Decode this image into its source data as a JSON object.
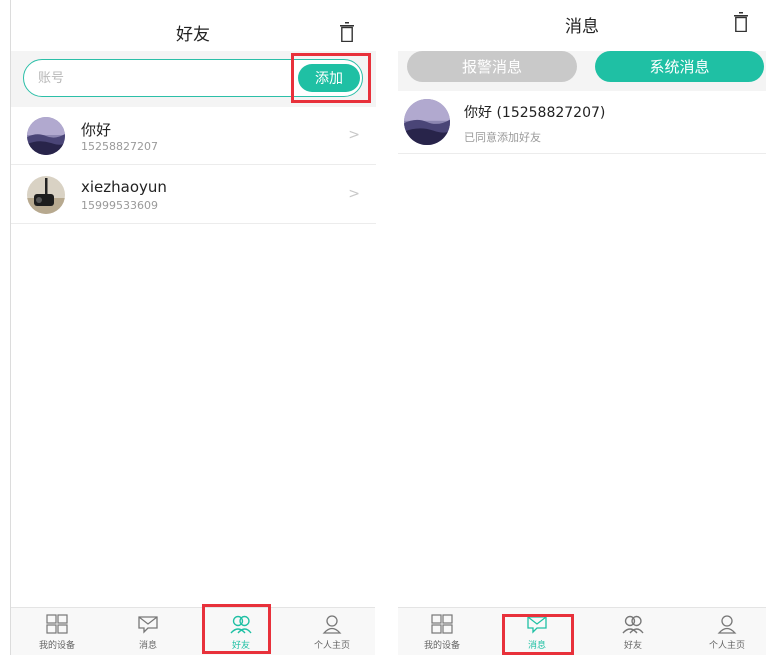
{
  "colors": {
    "accent": "#1fc0a4",
    "highlight": "#e8313b",
    "inactive_tab": "#c9c9c9"
  },
  "friends_screen": {
    "title": "好友",
    "trash_icon": "trash-icon",
    "search": {
      "placeholder": "账号",
      "value": ""
    },
    "add_button": "添加",
    "friends": [
      {
        "name": "你好",
        "phone": "15258827207",
        "avatar": "mountain-landscape"
      },
      {
        "name": "xiezhaoyun",
        "phone": "15999533609",
        "avatar": "camera-device-photo"
      }
    ],
    "chevron": ">"
  },
  "messages_screen": {
    "title": "消息",
    "trash_icon": "trash-icon",
    "tabs": [
      {
        "label": "报警消息",
        "active": false
      },
      {
        "label": "系统消息",
        "active": true
      }
    ],
    "messages": [
      {
        "title": "你好 (15258827207)",
        "body": "已同意添加好友",
        "avatar": "mountain-landscape"
      }
    ]
  },
  "tabbar_left": {
    "items": [
      {
        "label": "我的设备",
        "icon": "grid-icon",
        "active": false
      },
      {
        "label": "消息",
        "icon": "message-icon",
        "active": false
      },
      {
        "label": "好友",
        "icon": "friends-icon",
        "active": true
      },
      {
        "label": "个人主页",
        "icon": "person-icon",
        "active": false
      }
    ]
  },
  "tabbar_right": {
    "items": [
      {
        "label": "我的设备",
        "icon": "grid-icon",
        "active": false
      },
      {
        "label": "消息",
        "icon": "message-icon",
        "active": true
      },
      {
        "label": "好友",
        "icon": "friends-icon",
        "active": false
      },
      {
        "label": "个人主页",
        "icon": "person-icon",
        "active": false
      }
    ]
  }
}
